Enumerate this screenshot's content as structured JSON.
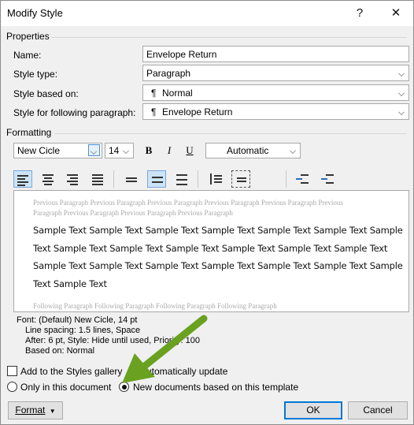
{
  "window": {
    "title": "Modify Style",
    "help_glyph": "?",
    "close_glyph": "✕"
  },
  "properties": {
    "heading": "Properties",
    "name_label": "Name:",
    "name_value": "Envelope Return",
    "style_type_label": "Style type:",
    "style_type_value": "Paragraph",
    "based_on_label": "Style based on:",
    "based_on_value": "Normal",
    "following_label": "Style for following paragraph:",
    "following_value": "Envelope Return",
    "para_glyph": "¶"
  },
  "formatting": {
    "heading": "Formatting",
    "font_value": "New Cicle",
    "size_value": "14",
    "bold": "B",
    "italic": "I",
    "underline": "U",
    "color_value": "Automatic"
  },
  "preview": {
    "previous_text": "Previous Paragraph Previous Paragraph Previous Paragraph Previous Paragraph Previous Paragraph Previous Paragraph Previous Paragraph Previous Paragraph Previous Paragraph",
    "sample_lines": [
      "Sample Text Sample Text Sample Text Sample Text Sample Text Sample Text Sample",
      "Text Sample Text Sample Text Sample Text Sample Text Sample Text Sample Text",
      "Sample Text Sample Text Sample Text Sample Text Sample Text Sample Text Sample",
      "Text Sample Text"
    ],
    "following_text": "Following Paragraph Following Paragraph Following Paragraph Following Paragraph"
  },
  "description": {
    "line1": "Font: (Default) New Cicle, 14 pt",
    "line2": "Line spacing:  1.5 lines, Space",
    "line3": "After:  6 pt, Style: Hide until used, Priority: 100",
    "line4": "Based on: Normal"
  },
  "options": {
    "add_to_gallery": "Add to the Styles gallery",
    "auto_update": "Automatically update",
    "only_this_doc": "Only in this document",
    "new_docs": "New documents based on this template"
  },
  "buttons": {
    "format": "Format",
    "ok": "OK",
    "cancel": "Cancel"
  },
  "colors": {
    "arrow": "#6aa121",
    "selection": "#cce4f7",
    "accent": "#0078d7"
  }
}
